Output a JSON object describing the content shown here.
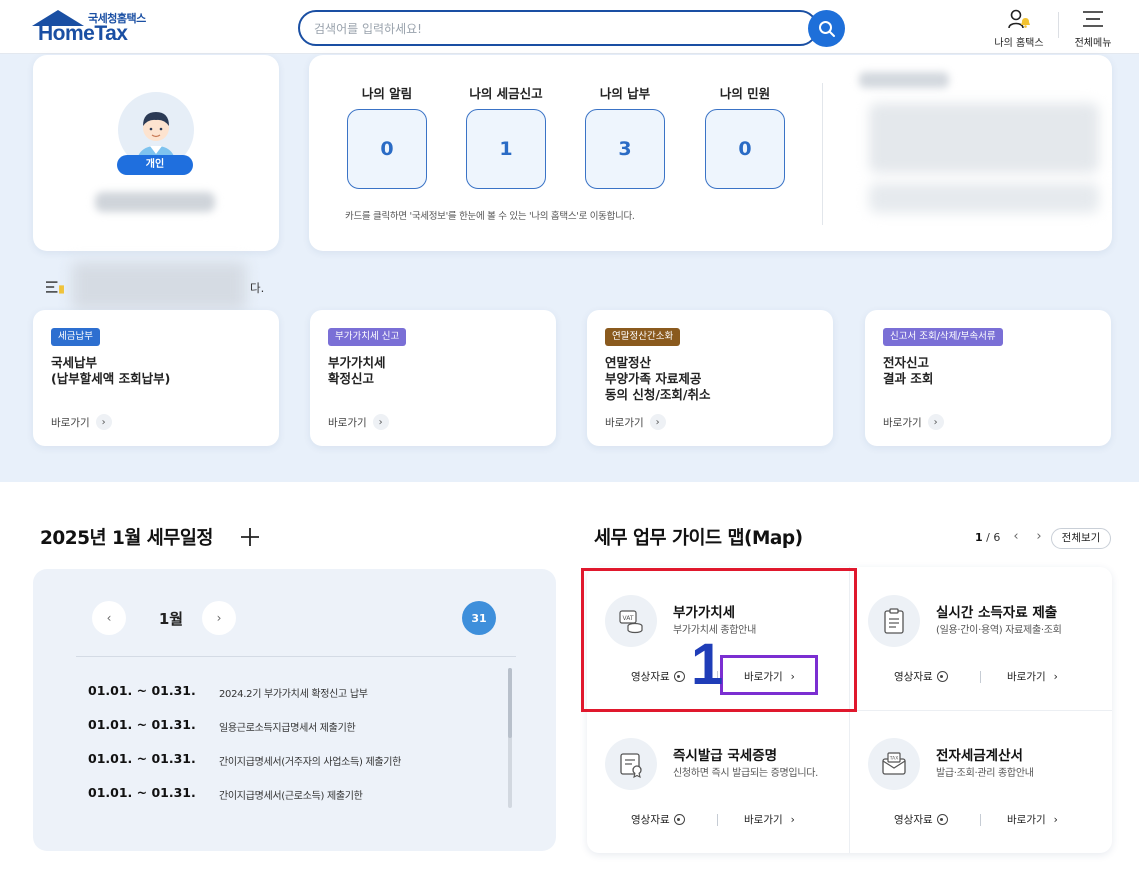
{
  "header": {
    "logo_sub": "국세청홈택스",
    "logo_main": "HomeTax",
    "search_placeholder": "검색어를 입력하세요!",
    "my_hometax_label": "나의 홈택스",
    "all_menu_label": "전체메뉴"
  },
  "profile": {
    "badge": "개인"
  },
  "stats": {
    "items": [
      {
        "title": "나의 알림",
        "value": "0"
      },
      {
        "title": "나의 세금신고",
        "value": "1"
      },
      {
        "title": "나의 납부",
        "value": "3"
      },
      {
        "title": "나의 민원",
        "value": "0"
      }
    ],
    "note": "카드를 클릭하면 '국세정보'를 한눈에 볼 수 있는 '나의 홈택스'로 이동합니다."
  },
  "message": {
    "tail": "다."
  },
  "quick_cards": [
    {
      "tag": "세금납부",
      "tag_color": "#2d6fd0",
      "title": "국세납부\n(납부할세액 조회납부)",
      "link": "바로가기"
    },
    {
      "tag": "부가가치세 신고",
      "tag_color": "#7a6fd6",
      "title": "부가가치세\n확정신고",
      "link": "바로가기"
    },
    {
      "tag": "연말정산간소화",
      "tag_color": "#8a5a1e",
      "title": "연말정산\n부양가족 자료제공\n동의 신청/조회/취소",
      "link": "바로가기"
    },
    {
      "tag": "신고서 조회/삭제/부속서류",
      "tag_color": "#7a6fd6",
      "title": "전자신고\n결과 조회",
      "link": "바로가기"
    }
  ],
  "schedule": {
    "title": "2025년 1월 세무일정",
    "month": "1월",
    "day": "31",
    "rows": [
      {
        "date": "01.01. ~ 01.31.",
        "desc": "2024.2기 부가가치세 확정신고 납부"
      },
      {
        "date": "01.01. ~ 01.31.",
        "desc": "일용근로소득지급명세서 제출기한"
      },
      {
        "date": "01.01. ~ 01.31.",
        "desc": "간이지급명세서(거주자의 사업소득) 제출기한"
      },
      {
        "date": "01.01. ~ 01.31.",
        "desc": "간이지급명세서(근로소득) 제출기한"
      }
    ]
  },
  "guide": {
    "title": "세무 업무 가이드 맵(Map)",
    "page_current": "1",
    "page_total": "/ 6",
    "view_all": "전체보기",
    "items": [
      {
        "title": "부가가치세",
        "sub": "부가가치세 종합안내",
        "video": "영상자료",
        "go": "바로가기",
        "icon": "vat-coins-icon"
      },
      {
        "title": "실시간 소득자료 제출",
        "sub": "(일용·간이·용역) 자료제출·조회",
        "video": "영상자료",
        "go": "바로가기",
        "icon": "clipboard-icon"
      },
      {
        "title": "즉시발급 국세증명",
        "sub": "신청하면 즉시 발급되는 증명입니다.",
        "video": "영상자료",
        "go": "바로가기",
        "icon": "certificate-icon"
      },
      {
        "title": "전자세금계산서",
        "sub": "발급·조회·관리 종합안내",
        "video": "영상자료",
        "go": "바로가기",
        "icon": "tax-envelope-icon"
      }
    ]
  },
  "annotation": {
    "number": "1"
  },
  "colors": {
    "brand": "#1a4fa3",
    "accent": "#1e6fd9",
    "highlight_red": "#e0182d",
    "highlight_purple": "#7b2fd1"
  }
}
